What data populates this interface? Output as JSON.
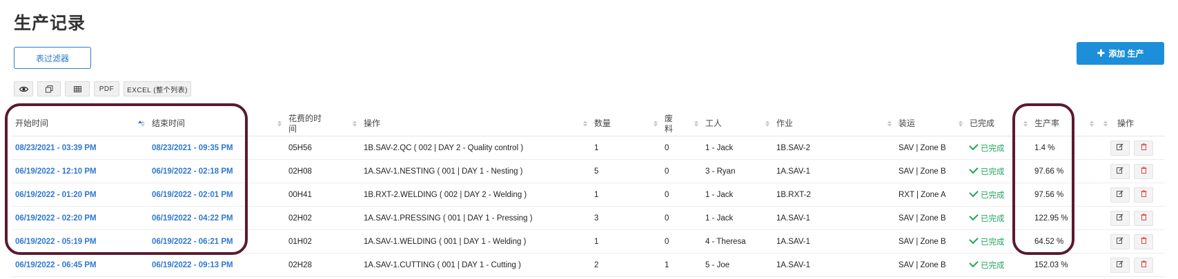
{
  "page": {
    "title": "生产记录"
  },
  "filter_button": "表过滤器",
  "add_button": "添加 生产",
  "toolbar": {
    "pdf": "PDF",
    "excel": "EXCEL (整个列表)"
  },
  "table": {
    "headers": [
      "开始时间",
      "结束时间",
      "花费的时间",
      "操作",
      "数量",
      "废料",
      "工人",
      "作业",
      "装运",
      "已完成",
      "生产率",
      "操作"
    ],
    "rows": [
      {
        "start": "08/23/2021 - 03:39 PM",
        "end": "08/23/2021 - 09:35 PM",
        "duration": "05H56",
        "operation": "1B.SAV-2.QC ( 002 | DAY 2 - Quality control )",
        "qty": "1",
        "scrap": "0",
        "worker": "1 - Jack",
        "job": "1B.SAV-2",
        "shipping": "SAV | Zone B",
        "done": "已完成",
        "rate": "1.4 %"
      },
      {
        "start": "06/19/2022 - 12:10 PM",
        "end": "06/19/2022 - 02:18 PM",
        "duration": "02H08",
        "operation": "1A.SAV-1.NESTING ( 001 | DAY 1 - Nesting )",
        "qty": "5",
        "scrap": "0",
        "worker": "3 - Ryan",
        "job": "1A.SAV-1",
        "shipping": "SAV | Zone B",
        "done": "已完成",
        "rate": "97.66 %"
      },
      {
        "start": "06/19/2022 - 01:20 PM",
        "end": "06/19/2022 - 02:01 PM",
        "duration": "00H41",
        "operation": "1B.RXT-2.WELDING ( 002 | DAY 2 - Welding )",
        "qty": "1",
        "scrap": "0",
        "worker": "1 - Jack",
        "job": "1B.RXT-2",
        "shipping": "RXT | Zone A",
        "done": "已完成",
        "rate": "97.56 %"
      },
      {
        "start": "06/19/2022 - 02:20 PM",
        "end": "06/19/2022 - 04:22 PM",
        "duration": "02H02",
        "operation": "1A.SAV-1.PRESSING ( 001 | DAY 1 - Pressing )",
        "qty": "3",
        "scrap": "0",
        "worker": "1 - Jack",
        "job": "1A.SAV-1",
        "shipping": "SAV | Zone B",
        "done": "已完成",
        "rate": "122.95 %"
      },
      {
        "start": "06/19/2022 - 05:19 PM",
        "end": "06/19/2022 - 06:21 PM",
        "duration": "01H02",
        "operation": "1A.SAV-1.WELDING ( 001 | DAY 1 - Welding )",
        "qty": "1",
        "scrap": "0",
        "worker": "4 - Theresa",
        "job": "1A.SAV-1",
        "shipping": "SAV | Zone B",
        "done": "已完成",
        "rate": "64.52 %"
      },
      {
        "start": "06/19/2022 - 06:45 PM",
        "end": "06/19/2022 - 09:13 PM",
        "duration": "02H28",
        "operation": "1A.SAV-1.CUTTING ( 001 | DAY 1 - Cutting )",
        "qty": "2",
        "scrap": "1",
        "worker": "5 - Joe",
        "job": "1A.SAV-1",
        "shipping": "SAV | Zone B",
        "done": "已完成",
        "rate": "152.03 %"
      }
    ]
  },
  "colors": {
    "link": "#2f78d2",
    "success": "#1fa65c",
    "primary": "#1d8ed9",
    "highlight": "#5a1a30",
    "delete": "#e04545"
  },
  "icons": {
    "visibility": "eye-icon",
    "copy": "copy-icon",
    "table": "table-icon",
    "edit": "edit-icon",
    "delete": "trash-icon"
  }
}
